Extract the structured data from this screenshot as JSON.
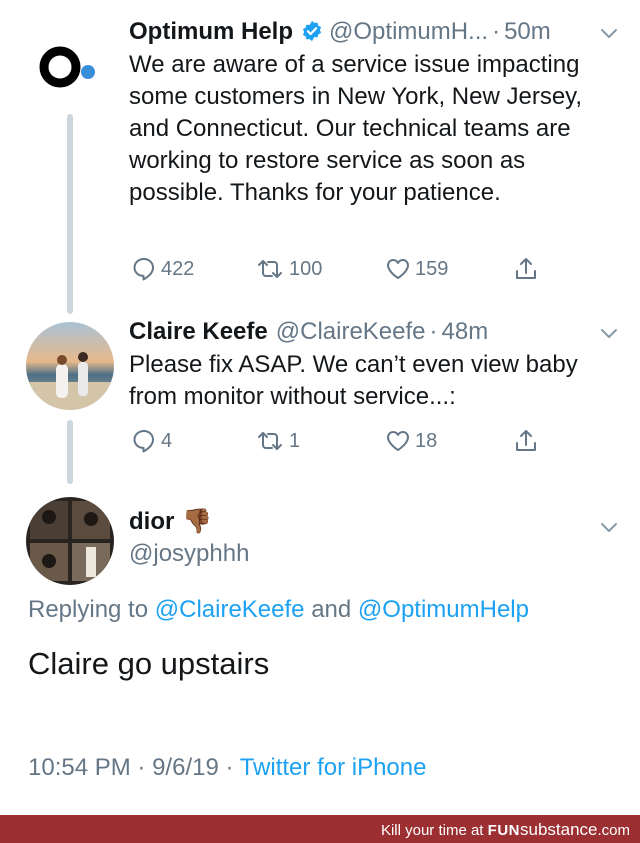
{
  "colors": {
    "blue": "#1da1f2",
    "gray": "#657786",
    "text": "#14171a",
    "thread": "#ccd6dd",
    "footer": "#9b2f31"
  },
  "tweets": [
    {
      "name": "Optimum Help",
      "verified": true,
      "handle": "@OptimumH...",
      "time": "50m",
      "text": "We are aware of a service issue impacting some customers in New York, New Jersey, and Connecticut. Our technical teams are working to restore service as soon as possible. Thanks for your patience.",
      "replies": "422",
      "retweets": "100",
      "likes": "159"
    },
    {
      "name": "Claire Keefe",
      "handle": "@ClaireKeefe",
      "time": "48m",
      "text": "Please fix ASAP. We can’t even view baby from monitor without service...:",
      "replies": "4",
      "retweets": "1",
      "likes": "18"
    }
  ],
  "main": {
    "name": "dior",
    "emoji": "👎🏾",
    "handle": "@josyphhh",
    "replying_prefix": "Replying to",
    "mention_1": "@ClaireKeefe",
    "replying_and": "and",
    "mention_2": "@OptimumHelp",
    "text": "Claire go upstairs",
    "time": "10:54 PM",
    "date": "9/6/19",
    "source": "Twitter for iPhone"
  },
  "footer": {
    "prefix": "Kill your time at",
    "brand_a": "FUN",
    "brand_b": "substance",
    "brand_c": ".com"
  },
  "separator": "·"
}
